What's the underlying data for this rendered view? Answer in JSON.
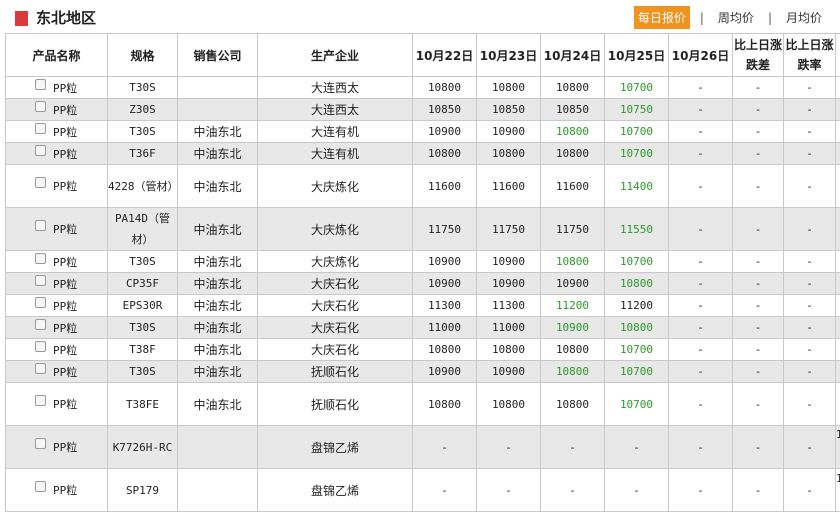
{
  "header": {
    "region_title": "东北地区",
    "tabs": [
      {
        "label": "每日报价",
        "active": true
      },
      {
        "label": "周均价",
        "active": false
      },
      {
        "label": "月均价",
        "active": false
      }
    ],
    "separator": "|"
  },
  "table": {
    "columns": [
      "产品名称",
      "规格",
      "销售公司",
      "生产企业",
      "10月22日",
      "10月23日",
      "10月24日",
      "10月25日",
      "10月26日",
      "比上日涨跌差",
      "比上日涨跌率"
    ],
    "rows": [
      {
        "product": "PP粒",
        "spec": "T30S",
        "seller": "",
        "producer": "大连西太",
        "d22": "10800",
        "d23": "10800",
        "d24": "10800",
        "d25": "10700",
        "d26": "-",
        "diff": "-",
        "rate": "-"
      },
      {
        "product": "PP粒",
        "spec": "Z30S",
        "seller": "",
        "producer": "大连西太",
        "d22": "10850",
        "d23": "10850",
        "d24": "10850",
        "d25": "10750",
        "d26": "-",
        "diff": "-",
        "rate": "-"
      },
      {
        "product": "PP粒",
        "spec": "T30S",
        "seller": "中油东北",
        "producer": "大连有机",
        "d22": "10900",
        "d23": "10900",
        "d24": "10800",
        "d25": "10700",
        "d26": "-",
        "diff": "-",
        "rate": "-"
      },
      {
        "product": "PP粒",
        "spec": "T36F",
        "seller": "中油东北",
        "producer": "大连有机",
        "d22": "10800",
        "d23": "10800",
        "d24": "10800",
        "d25": "10700",
        "d26": "-",
        "diff": "-",
        "rate": "-"
      },
      {
        "product": "PP粒",
        "spec": "4228（管材）",
        "seller": "中油东北",
        "producer": "大庆炼化",
        "d22": "11600",
        "d23": "11600",
        "d24": "11600",
        "d25": "11400",
        "d26": "-",
        "diff": "-",
        "rate": "-"
      },
      {
        "product": "PP粒",
        "spec": "PA14D（管材）",
        "seller": "中油东北",
        "producer": "大庆炼化",
        "d22": "11750",
        "d23": "11750",
        "d24": "11750",
        "d25": "11550",
        "d26": "-",
        "diff": "-",
        "rate": "-"
      },
      {
        "product": "PP粒",
        "spec": "T30S",
        "seller": "中油东北",
        "producer": "大庆炼化",
        "d22": "10900",
        "d23": "10900",
        "d24": "10800",
        "d25": "10700",
        "d26": "-",
        "diff": "-",
        "rate": "-"
      },
      {
        "product": "PP粒",
        "spec": "CP35F",
        "seller": "中油东北",
        "producer": "大庆石化",
        "d22": "10900",
        "d23": "10900",
        "d24": "10900",
        "d25": "10800",
        "d26": "-",
        "diff": "-",
        "rate": "-"
      },
      {
        "product": "PP粒",
        "spec": "EPS30R",
        "seller": "中油东北",
        "producer": "大庆石化",
        "d22": "11300",
        "d23": "11300",
        "d24": "11200",
        "d25": "11200",
        "d26": "-",
        "diff": "-",
        "rate": "-"
      },
      {
        "product": "PP粒",
        "spec": "T30S",
        "seller": "中油东北",
        "producer": "大庆石化",
        "d22": "11000",
        "d23": "11000",
        "d24": "10900",
        "d25": "10800",
        "d26": "-",
        "diff": "-",
        "rate": "-"
      },
      {
        "product": "PP粒",
        "spec": "T38F",
        "seller": "中油东北",
        "producer": "大庆石化",
        "d22": "10800",
        "d23": "10800",
        "d24": "10800",
        "d25": "10700",
        "d26": "-",
        "diff": "-",
        "rate": "-"
      },
      {
        "product": "PP粒",
        "spec": "T30S",
        "seller": "中油东北",
        "producer": "抚顺石化",
        "d22": "10900",
        "d23": "10900",
        "d24": "10800",
        "d25": "10700",
        "d26": "-",
        "diff": "-",
        "rate": "-"
      },
      {
        "product": "PP粒",
        "spec": "T38FE",
        "seller": "中油东北",
        "producer": "抚顺石化",
        "d22": "10800",
        "d23": "10800",
        "d24": "10800",
        "d25": "10700",
        "d26": "-",
        "diff": "-",
        "rate": "-"
      },
      {
        "product": "PP粒",
        "spec": "K7726H-RC",
        "seller": "",
        "producer": "盘锦乙烯",
        "d22": "-",
        "d23": "-",
        "d24": "-",
        "d25": "-",
        "d26": "-",
        "diff": "-",
        "rate": "-"
      },
      {
        "product": "PP粒",
        "spec": "SP179",
        "seller": "",
        "producer": "盘锦乙烯",
        "d22": "-",
        "d23": "-",
        "d24": "-",
        "d25": "-",
        "d26": "-",
        "diff": "-",
        "rate": "-"
      }
    ],
    "row_styles": [
      {
        "alt": false,
        "tall": false,
        "green24": false,
        "green25": true
      },
      {
        "alt": true,
        "tall": false,
        "green24": false,
        "green25": true
      },
      {
        "alt": false,
        "tall": false,
        "green24": true,
        "green25": true
      },
      {
        "alt": true,
        "tall": false,
        "green24": false,
        "green25": true
      },
      {
        "alt": false,
        "tall": true,
        "green24": false,
        "green25": true
      },
      {
        "alt": true,
        "tall": true,
        "green24": false,
        "green25": true
      },
      {
        "alt": false,
        "tall": false,
        "green24": true,
        "green25": true
      },
      {
        "alt": true,
        "tall": false,
        "green24": false,
        "green25": true
      },
      {
        "alt": false,
        "tall": false,
        "green24": true,
        "green25": false
      },
      {
        "alt": true,
        "tall": false,
        "green24": true,
        "green25": true
      },
      {
        "alt": false,
        "tall": false,
        "green24": false,
        "green25": true
      },
      {
        "alt": true,
        "tall": false,
        "green24": true,
        "green25": true
      },
      {
        "alt": false,
        "tall": true,
        "green24": false,
        "green25": true
      },
      {
        "alt": true,
        "tall": true,
        "green24": false,
        "green25": false
      },
      {
        "alt": false,
        "tall": true,
        "green24": false,
        "green25": false
      }
    ],
    "overflow_marks": [
      "1",
      "1"
    ]
  },
  "colors": {
    "accent": "#f0921e",
    "marker_red": "#d93a3a",
    "price_down_green": "#2a9a2a",
    "alt_row": "#e8e8e8",
    "border": "#c8c8c8"
  }
}
